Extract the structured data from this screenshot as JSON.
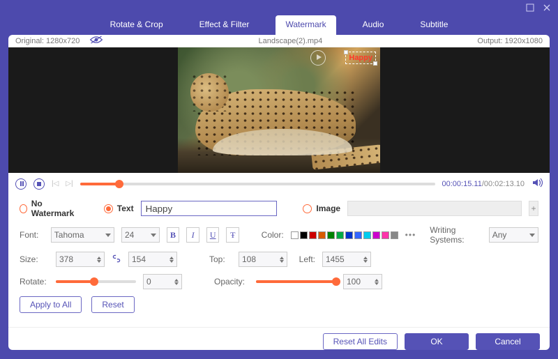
{
  "tabs": [
    "Rotate & Crop",
    "Effect & Filter",
    "Watermark",
    "Audio",
    "Subtitle"
  ],
  "activeTab": 2,
  "info": {
    "originalLabel": "Original: 1280x720",
    "filename": "Landscape(2).mp4",
    "outputLabel": "Output: 1920x1080"
  },
  "watermarkText": "Happy",
  "playback": {
    "current": "00:00:15.11",
    "duration": "00:02:13.10"
  },
  "radios": {
    "none": "No Watermark",
    "text": "Text",
    "image": "Image"
  },
  "controls": {
    "fontLabel": "Font:",
    "font": "Tahoma",
    "fontSize": "24",
    "colorLabel": "Color:",
    "writingLabel": "Writing Systems:",
    "writing": "Any",
    "sizeLabel": "Size:",
    "sizeW": "378",
    "sizeH": "154",
    "topLabel": "Top:",
    "top": "108",
    "leftLabel": "Left:",
    "left": "1455",
    "rotateLabel": "Rotate:",
    "rotate": "0",
    "opacityLabel": "Opacity:",
    "opacity": "100",
    "applyAll": "Apply to All",
    "reset": "Reset"
  },
  "swatches": [
    "#ffffff",
    "#000000",
    "#cc0000",
    "#d85a00",
    "#008000",
    "#00aa44",
    "#0033cc",
    "#3366ff",
    "#00ccee",
    "#cc00cc",
    "#ff33aa",
    "#888888"
  ],
  "footer": {
    "resetAll": "Reset All Edits",
    "ok": "OK",
    "cancel": "Cancel"
  }
}
